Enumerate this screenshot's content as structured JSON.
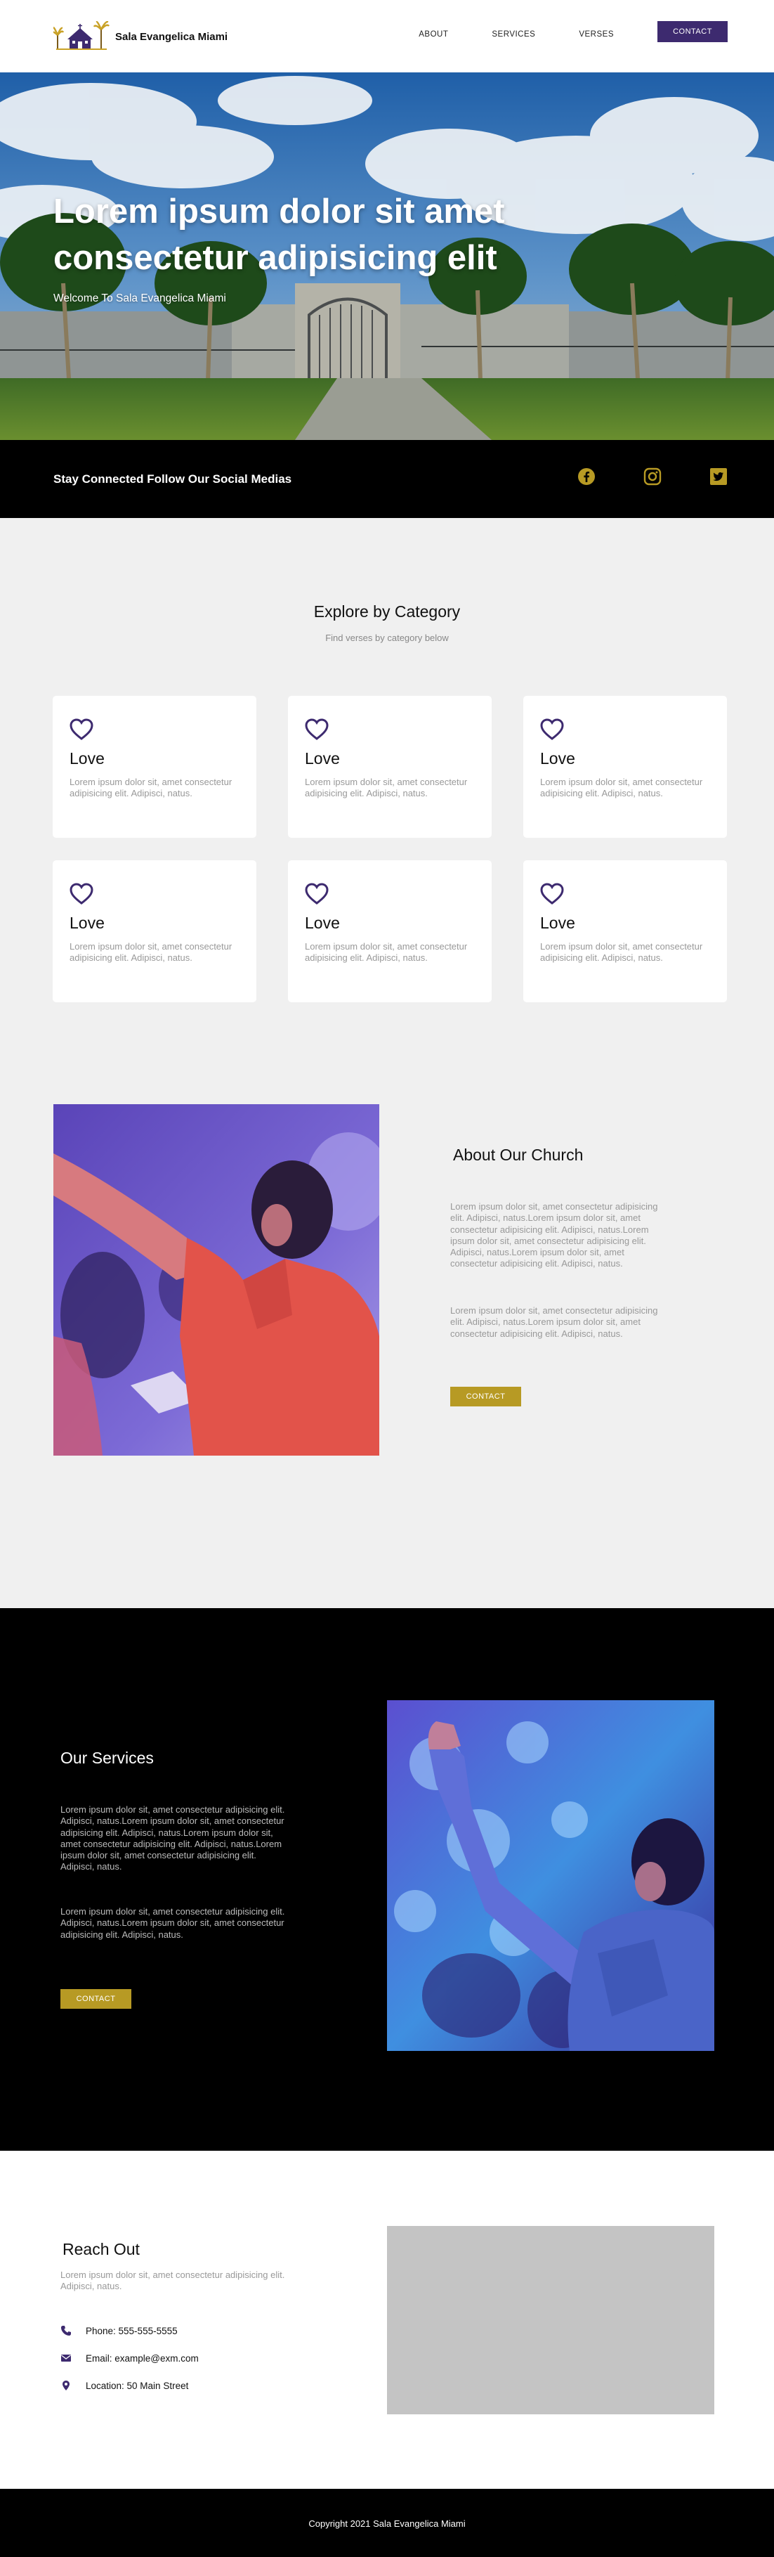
{
  "nav": {
    "brand": "Sala Evangelica Miami",
    "links": [
      "ABOUT",
      "SERVICES",
      "VERSES"
    ],
    "contact_label": "CONTACT"
  },
  "hero": {
    "title": "Lorem ipsum dolor sit amet consectetur adipisicing elit",
    "subtitle": "Welcome To Sala Evangelica Miami"
  },
  "social": {
    "text": "Stay Connected Follow Our Social Medias",
    "icons": [
      "facebook-icon",
      "instagram-icon",
      "twitter-icon"
    ],
    "icon_color": "#b79a24"
  },
  "explore": {
    "title": "Explore by Category",
    "subtitle": "Find verses by category below",
    "cards": [
      {
        "title": "Love",
        "text": "Lorem ipsum dolor sit, amet consectetur adipisicing elit. Adipisci, natus."
      },
      {
        "title": "Love",
        "text": "Lorem ipsum dolor sit, amet consectetur adipisicing elit. Adipisci, natus."
      },
      {
        "title": "Love",
        "text": "Lorem ipsum dolor sit, amet consectetur adipisicing elit. Adipisci, natus."
      },
      {
        "title": "Love",
        "text": "Lorem ipsum dolor sit, amet consectetur adipisicing elit. Adipisci, natus."
      },
      {
        "title": "Love",
        "text": "Lorem ipsum dolor sit, amet consectetur adipisicing elit. Adipisci, natus."
      },
      {
        "title": "Love",
        "text": "Lorem ipsum dolor sit, amet consectetur adipisicing elit. Adipisci, natus."
      }
    ],
    "icon_color": "#3d2a6f"
  },
  "about": {
    "title": "About Our Church",
    "p1": "Lorem ipsum dolor sit, amet consectetur adipisicing elit. Adipisci, natus.Lorem ipsum dolor sit, amet consectetur adipisicing elit. Adipisci, natus.Lorem ipsum dolor sit, amet consectetur adipisicing elit. Adipisci, natus.Lorem ipsum dolor sit, amet consectetur adipisicing elit. Adipisci, natus.",
    "p2": "Lorem ipsum dolor sit, amet consectetur adipisicing elit. Adipisci, natus.Lorem ipsum dolor sit, amet consectetur adipisicing elit. Adipisci, natus.",
    "button": "CONTACT"
  },
  "services": {
    "title": "Our Services",
    "p1": "Lorem ipsum dolor sit, amet consectetur adipisicing elit. Adipisci, natus.Lorem ipsum dolor sit, amet consectetur adipisicing elit. Adipisci, natus.Lorem ipsum dolor sit, amet consectetur adipisicing elit. Adipisci, natus.Lorem ipsum dolor sit, amet consectetur adipisicing elit. Adipisci, natus.",
    "p2": "Lorem ipsum dolor sit, amet consectetur adipisicing elit. Adipisci, natus.Lorem ipsum dolor sit, amet consectetur adipisicing elit. Adipisci, natus.",
    "button": "CONTACT"
  },
  "reach": {
    "title": "Reach Out",
    "text": "Lorem ipsum dolor sit, amet consectetur adipisicing elit. Adipisci, natus.",
    "phone": "Phone: 555-555-5555",
    "email": "Email: example@exm.com",
    "location": "Location: 50 Main Street"
  },
  "footer": {
    "text": "Copyright 2021 Sala Evangelica Miami"
  },
  "colors": {
    "accent_purple": "#3d2a6f",
    "accent_gold": "#b79a24"
  }
}
